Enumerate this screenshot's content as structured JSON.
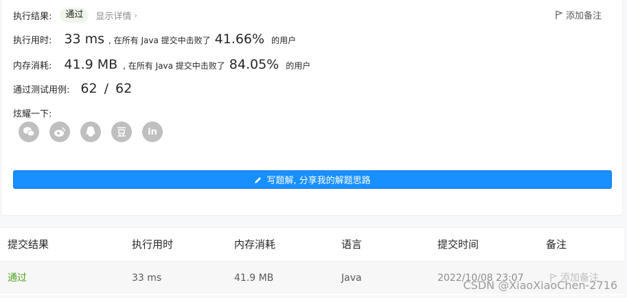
{
  "result": {
    "label": "执行结果:",
    "status": "通过",
    "details_link": "显示详情",
    "add_note": "添加备注"
  },
  "runtime": {
    "label": "执行用时:",
    "value": "33 ms",
    "beat_text": ", 在所有 Java 提交中击败了",
    "percent": "41.66%",
    "suffix": "的用户"
  },
  "memory": {
    "label": "内存消耗:",
    "value": "41.9 MB",
    "beat_text": ", 在所有 Java 提交中击败了",
    "percent": "84.05%",
    "suffix": "的用户"
  },
  "testcases": {
    "label": "通过测试用例:",
    "passed": "62",
    "separator": "/",
    "total": "62"
  },
  "share": {
    "label": "炫耀一下:",
    "icons": [
      "wechat-icon",
      "weibo-icon",
      "qq-icon",
      "douban-icon",
      "linkedin-icon"
    ]
  },
  "write_solution_button": "写题解, 分享我的解题思路",
  "submissions": {
    "headers": {
      "status": "提交结果",
      "runtime": "执行用时",
      "memory": "内存消耗",
      "language": "语言",
      "time": "提交时间",
      "note": "备注"
    },
    "rows": [
      {
        "status": "通过",
        "runtime": "33 ms",
        "memory": "41.9 MB",
        "language": "Java",
        "time": "2022/10/08 23:07",
        "note": "添加备注"
      }
    ]
  },
  "watermark": "CSDN @XiaoXiaoChen-2716",
  "colors": {
    "accent": "#1890ff",
    "pass": "#52a322",
    "icon_gray": "#bfbfbf"
  }
}
